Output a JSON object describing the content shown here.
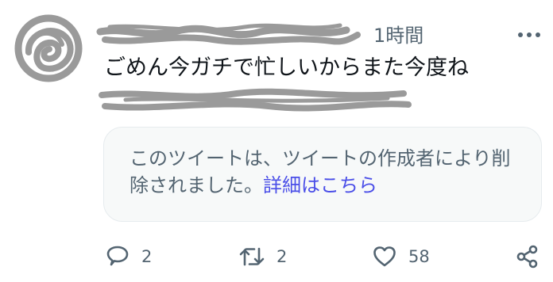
{
  "tweet": {
    "time": "1時間",
    "text": "ごめん今ガチで忙しいからまた今度ね",
    "quote": {
      "message": "このツイートは、ツイートの作成者により削除されました。",
      "link": "詳細はこちら"
    },
    "actions": {
      "reply_count": "2",
      "retweet_count": "2",
      "like_count": "58"
    }
  },
  "icons": {
    "avatar": "avatar-scribble",
    "more": "more-dots-icon",
    "reply": "reply-icon",
    "retweet": "retweet-icon",
    "like": "heart-icon",
    "share": "share-icon"
  },
  "colors": {
    "text_primary": "#0f1419",
    "text_secondary": "#536471",
    "link": "#4a4ee8",
    "quote_background": "#f7f9f9",
    "quote_border": "#e6ebee",
    "scribble": "#9a9a9a"
  }
}
